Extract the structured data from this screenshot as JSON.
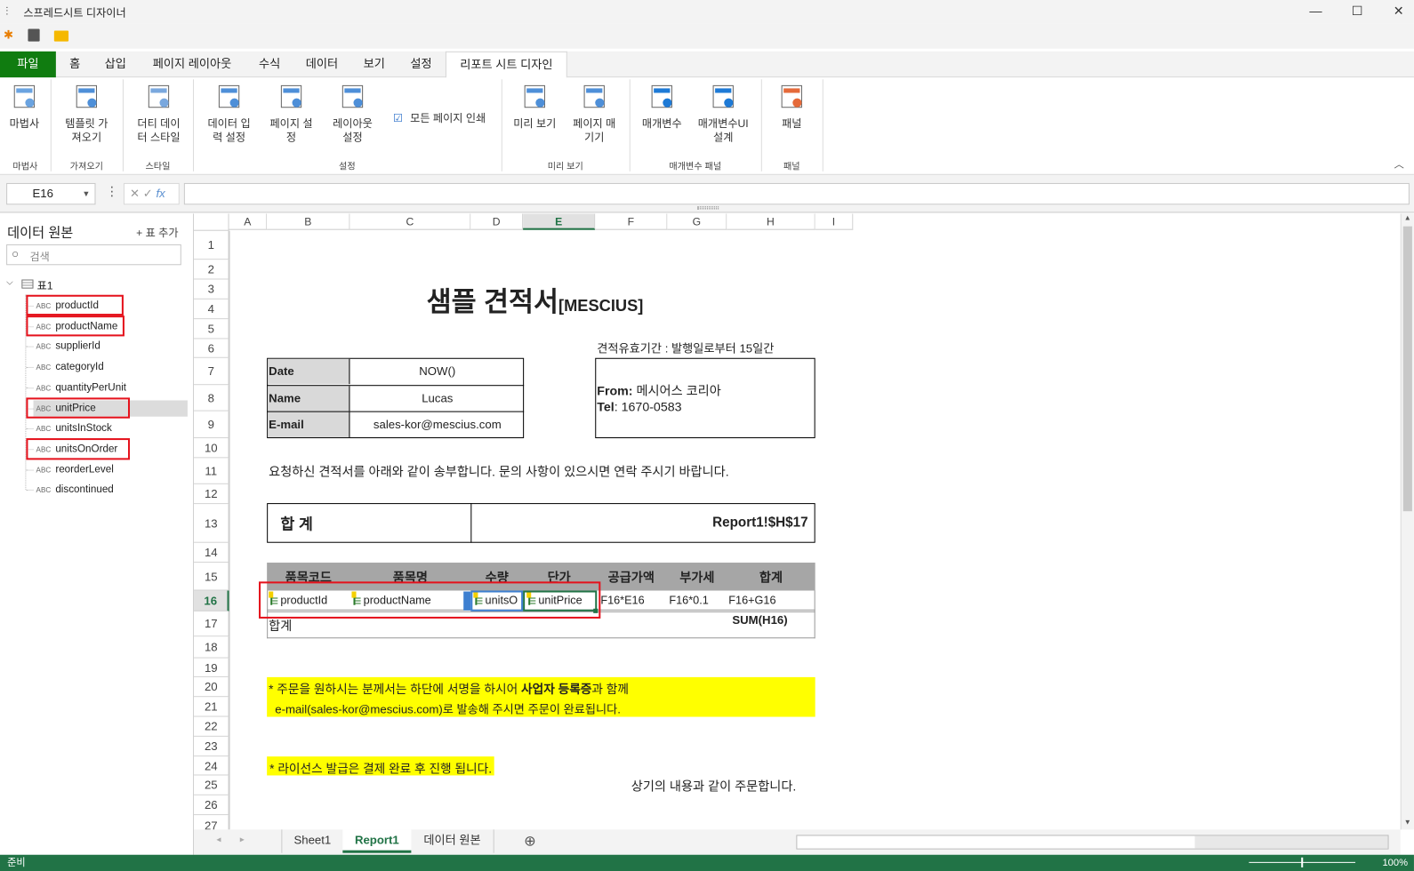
{
  "app": {
    "title": "스프레드시트 디자이너"
  },
  "tabs": [
    {
      "label": "파일"
    },
    {
      "label": "홈"
    },
    {
      "label": "삽입"
    },
    {
      "label": "페이지 레이아웃"
    },
    {
      "label": "수식"
    },
    {
      "label": "데이터"
    },
    {
      "label": "보기"
    },
    {
      "label": "설정"
    },
    {
      "label": "리포트 시트 디자인"
    }
  ],
  "ribbon": {
    "buttons": [
      {
        "l1": "마법사",
        "l2": ""
      },
      {
        "l1": "템플릿 가",
        "l2": "져오기"
      },
      {
        "l1": "더티 데이",
        "l2": "터 스타일"
      },
      {
        "l1": "데이터 입",
        "l2": "력 설정"
      },
      {
        "l1": "페이지 설",
        "l2": "정"
      },
      {
        "l1": "레이아웃",
        "l2": "설정"
      },
      {
        "l1": "미리 보기",
        "l2": ""
      },
      {
        "l1": "페이지 매",
        "l2": "기기"
      },
      {
        "l1": "매개변수",
        "l2": ""
      },
      {
        "l1": "매개변수UI",
        "l2": "설계"
      },
      {
        "l1": "패널",
        "l2": ""
      }
    ],
    "print_all_label": "모든 페이지 인쇄",
    "print_all_checked": true,
    "groups": [
      "마법사",
      "가져오기",
      "스타일",
      "설정",
      "미리 보기",
      "매개변수 패널",
      "패널"
    ]
  },
  "formula_bar": {
    "cell_ref": "E16",
    "formula": ""
  },
  "side": {
    "title": "데이터 원본",
    "add_table": "+ 표 추가",
    "search_placeholder": "검색",
    "table_name": "표1",
    "type_tag": "ABC",
    "fields": [
      {
        "name": "productId",
        "marked": true
      },
      {
        "name": "productName",
        "marked": true
      },
      {
        "name": "supplierId",
        "marked": false
      },
      {
        "name": "categoryId",
        "marked": false
      },
      {
        "name": "quantityPerUnit",
        "marked": false
      },
      {
        "name": "unitPrice",
        "marked": true
      },
      {
        "name": "unitsInStock",
        "marked": false
      },
      {
        "name": "unitsOnOrder",
        "marked": true
      },
      {
        "name": "reorderLevel",
        "marked": false
      },
      {
        "name": "discontinued",
        "marked": false
      }
    ]
  },
  "columns": [
    "A",
    "B",
    "C",
    "D",
    "E",
    "F",
    "G",
    "H",
    "I"
  ],
  "rows": [
    "1",
    "2",
    "3",
    "4",
    "5",
    "6",
    "7",
    "8",
    "9",
    "10",
    "11",
    "12",
    "13",
    "14",
    "15",
    "16",
    "17",
    "18",
    "19",
    "20",
    "21",
    "22",
    "23",
    "24",
    "25",
    "26",
    "27"
  ],
  "sheet": {
    "title": "샘플 견적서",
    "title_suffix": "[MESCIUS]",
    "validity": "견적유효기간 :  발행일로부터 15일간",
    "info": [
      {
        "k": "Date",
        "v": "NOW()"
      },
      {
        "k": "Name",
        "v": "Lucas"
      },
      {
        "k": "E-mail",
        "v": "sales-kor@mescius.com"
      }
    ],
    "from_label": "From:",
    "from_value": " 메시어스 코리아",
    "tel_label": "Tel",
    "tel_value": ": 1670-0583",
    "intro": "요청하신 견적서를 아래와 같이 송부합니다. 문의 사항이 있으시면 연락 주시기 바랍니다.",
    "total_label": "합 계",
    "total_value": "Report1!$H$17",
    "headers": [
      "품목코드",
      "품목명",
      "수량",
      "단가",
      "공급가액",
      "부가세",
      "합계"
    ],
    "row16": [
      "productId",
      "productName",
      "unitsO",
      "unitPrice",
      "F16*E16",
      "F16*0.1",
      "F16+G16"
    ],
    "row17_label": "합계",
    "row17_sum": "SUM(H16)",
    "note1a": "* 주문을 원하시는 분께서는 하단에 서명을 하시어 ",
    "note1b": "사업자 등록증",
    "note1c": "과 함께",
    "note2": "e-mail(sales-kor@mescius.com)로 발송해 주시면 주문이 완료됩니다.",
    "note3": "* 라이선스 발급은 결제 완료 후 진행 됩니다.",
    "closing": "상기의 내용과 같이 주문합니다."
  },
  "sheet_tabs": [
    {
      "label": "Sheet1"
    },
    {
      "label": "Report1",
      "active": true
    },
    {
      "label": "데이터 원본"
    }
  ],
  "status": {
    "text": "준비",
    "zoom": "100%"
  },
  "colors": {
    "accent": "#217346",
    "file_tab": "#107c10",
    "highlight": "#ffff00",
    "marker": "#e5121c"
  }
}
